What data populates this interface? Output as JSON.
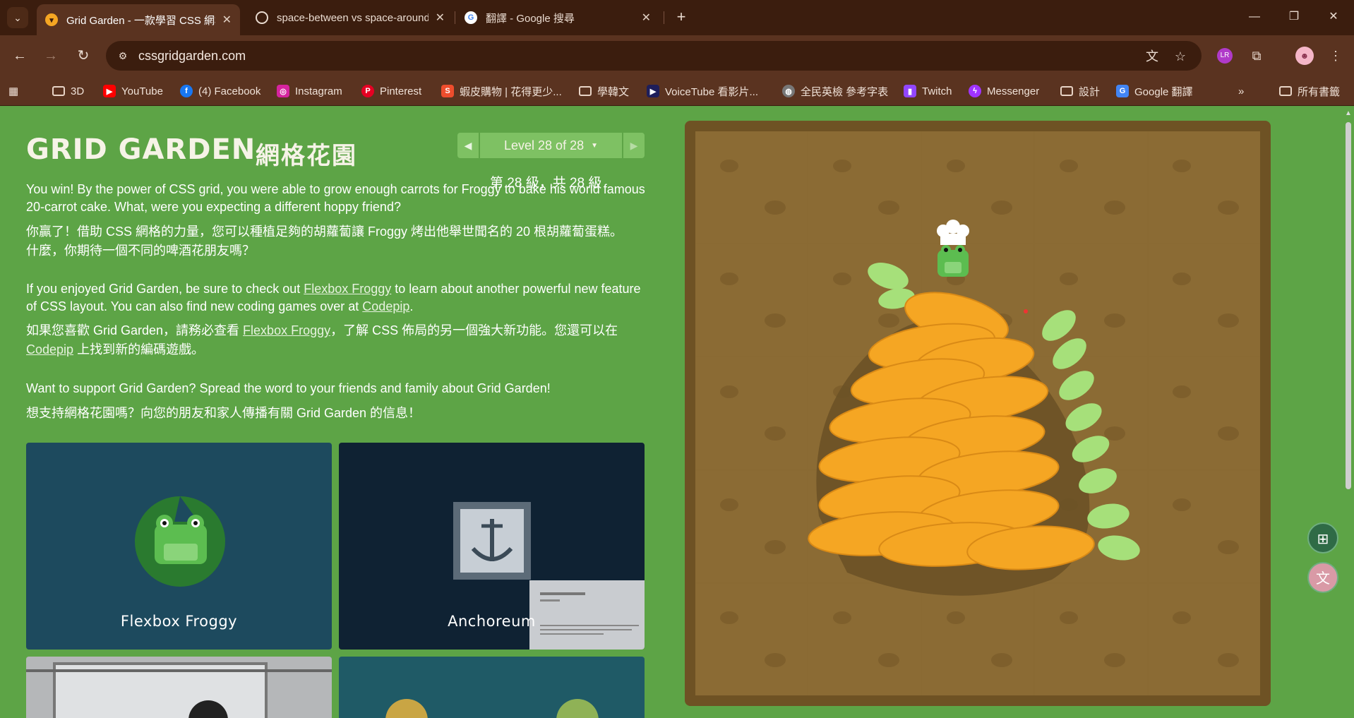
{
  "browser": {
    "tabs": [
      {
        "title": "Grid Garden - 一款學習 CSS 網格的遊戲",
        "active": true,
        "favicon": "carrot-icon"
      },
      {
        "title": "space-between vs space-around",
        "active": false,
        "favicon": "openai-icon"
      },
      {
        "title": "翻譯 - Google 搜尋",
        "active": false,
        "favicon": "google-icon"
      }
    ],
    "url": "cssgridgarden.com",
    "profile_badge": "LR",
    "bookmarks": [
      {
        "label": "3D",
        "icon": "folder-icon"
      },
      {
        "label": "YouTube",
        "icon": "youtube-icon"
      },
      {
        "label": "(4) Facebook",
        "icon": "facebook-icon"
      },
      {
        "label": "Instagram",
        "icon": "instagram-icon"
      },
      {
        "label": "Pinterest",
        "icon": "pinterest-icon"
      },
      {
        "label": "蝦皮購物 | 花得更少...",
        "icon": "shopee-icon"
      },
      {
        "label": "學韓文",
        "icon": "folder-icon"
      },
      {
        "label": "VoiceTube 看影片...",
        "icon": "voicetube-icon"
      },
      {
        "label": "全民英檢 參考字表",
        "icon": "globe-icon"
      },
      {
        "label": "Twitch",
        "icon": "twitch-icon"
      },
      {
        "label": "Messenger",
        "icon": "messenger-icon"
      },
      {
        "label": "設計",
        "icon": "folder-icon"
      },
      {
        "label": "Google 翻譯",
        "icon": "google-translate-icon"
      }
    ],
    "all_bookmarks_label": "所有書籤"
  },
  "game": {
    "logo": "GRID GARDEN",
    "logo_zh": "網格花園",
    "level_label": "Level 28 of 28",
    "level_zh": "第 28 級，共 28 級",
    "win_en": "You win! By the power of CSS grid, you were able to grow enough carrots for Froggy to bake his world famous 20-carrot cake. What, were you expecting a different hoppy friend?",
    "win_zh_1": "你贏了！借助 CSS 網格的力量，您可以種植足夠的胡蘿蔔讓 Froggy 烤出他舉世聞名的 20 根胡蘿蔔蛋糕。",
    "win_zh_2": "什麼，你期待一個不同的啤酒花朋友嗎？",
    "enjoy_en_1": "If you enjoyed Grid Garden, be sure to check out ",
    "enjoy_link_1": "Flexbox Froggy",
    "enjoy_en_2": " to learn about another powerful new feature of CSS layout. You can also find new coding games over at ",
    "enjoy_link_2": "Codepip",
    "enjoy_en_3": ".",
    "enjoy_zh_1": "如果您喜歡 Grid Garden，請務必查看 ",
    "enjoy_zh_link_1": "Flexbox Froggy",
    "enjoy_zh_2": "，了解 CSS 佈局的另一個強大新功能。您還可以在",
    "enjoy_zh_link_2": "Codepip",
    "enjoy_zh_3": " 上找到新的編碼遊戲。",
    "support_en": "Want to support Grid Garden? Spread the word to your friends and family about Grid Garden!",
    "support_zh": "想支持網格花園嗎？向您的朋友和家人傳播有關 Grid Garden 的信息！",
    "cards": [
      {
        "title": "Flexbox Froggy",
        "color": "#1d4a5e"
      },
      {
        "title": "Anchoreum",
        "color": "#0f2233"
      }
    ]
  },
  "colors": {
    "page_bg": "#5da446",
    "board_frame": "#6e5224",
    "soil": "#8b6b34",
    "carrot": "#f5a623",
    "leaf": "#8fd14f"
  }
}
